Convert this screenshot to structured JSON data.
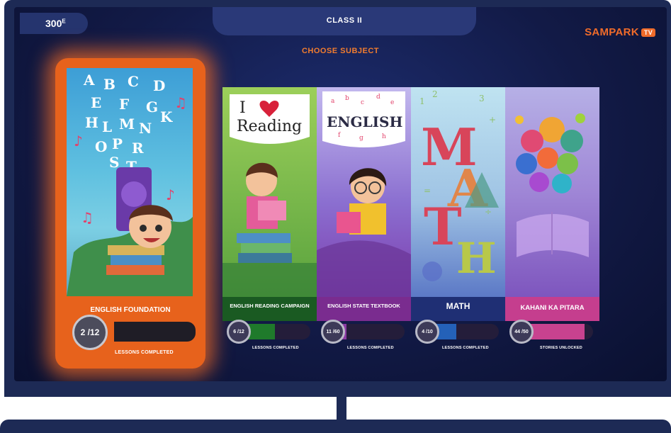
{
  "header": {
    "score": "300",
    "score_unit": "E",
    "class_label": "CLASS II",
    "logo_text": "SAMPARK",
    "logo_badge": "TV",
    "prompt": "CHOOSE SUBJECT"
  },
  "featured": {
    "title": "ENGLISH FOUNDATION",
    "progress_text": "2 /12",
    "progress_fraction": 0.1667,
    "caption": "LESSONS COMPLETED"
  },
  "cards": [
    {
      "title": "ENGLISH READING CAMPAIGN",
      "art_text": [
        "I",
        "Reading"
      ],
      "progress_text": "6 /12",
      "progress_fraction": 0.5,
      "caption": "LESSONS COMPLETED",
      "color": "#1f7a2b"
    },
    {
      "title": "ENGLISH STATE TEXTBOOK",
      "art_text": [
        "ENGLISH"
      ],
      "progress_text": "11 /60",
      "progress_fraction": 0.18,
      "caption": "LESSONS COMPLETED",
      "color": "#8a3aa3"
    },
    {
      "title": "MATH",
      "art_text": [
        "M",
        "A",
        "T",
        "H"
      ],
      "progress_text": "4 /10",
      "progress_fraction": 0.4,
      "caption": "LESSONS COMPLETED",
      "color": "#2461b8"
    },
    {
      "title": "KAHANI KA PITARA",
      "progress_text": "44 /50",
      "progress_fraction": 0.88,
      "caption": "STORIES UNLOCKED",
      "color": "#c8428f"
    }
  ]
}
